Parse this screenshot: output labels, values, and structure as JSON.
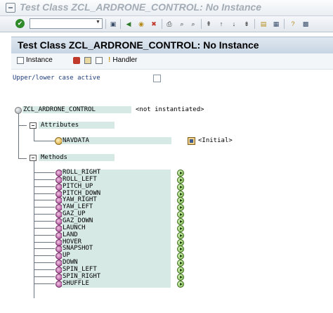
{
  "window": {
    "title": "Test Class ZCL_ARDRONE_CONTROL: No Instance"
  },
  "toolbar": {
    "command_field_value": "",
    "icons": [
      "enter-icon",
      "command-dropdown-icon",
      "save-icon",
      "back-icon",
      "exit-icon",
      "cancel-icon",
      "print-icon",
      "find-icon",
      "find-next-icon",
      "first-page-icon",
      "previous-page-icon",
      "next-page-icon",
      "last-page-icon",
      "create-session-icon",
      "shortcut-icon",
      "help-icon",
      "customize-layout-icon"
    ]
  },
  "header": {
    "title": "Test Class ZCL_ARDRONE_CONTROL: No Instance"
  },
  "app_toolbar": {
    "instance_label": "Instance",
    "handler_label": "Handler"
  },
  "options": {
    "case_label": "Upper/lower case active",
    "case_checked": false
  },
  "tree": {
    "root": {
      "label": "ZCL_ARDRONE_CONTROL",
      "value": "<not instantiated>"
    },
    "attributes_label": "Attributes",
    "attributes": [
      {
        "label": "NAVDATA",
        "value": "<Initial>"
      }
    ],
    "methods_label": "Methods",
    "methods": [
      "ROLL_RIGHT",
      "ROLL_LEFT",
      "PITCH_UP",
      "PITCH_DOWN",
      "YAW_RIGHT",
      "YAW_LEFT",
      "GAZ_UP",
      "GAZ_DOWN",
      "LAUNCH",
      "LAND",
      "HOVER",
      "SNAPSHOT",
      "UP",
      "DOWN",
      "SPIN_LEFT",
      "SPIN_RIGHT",
      "SHUFFLE"
    ]
  }
}
